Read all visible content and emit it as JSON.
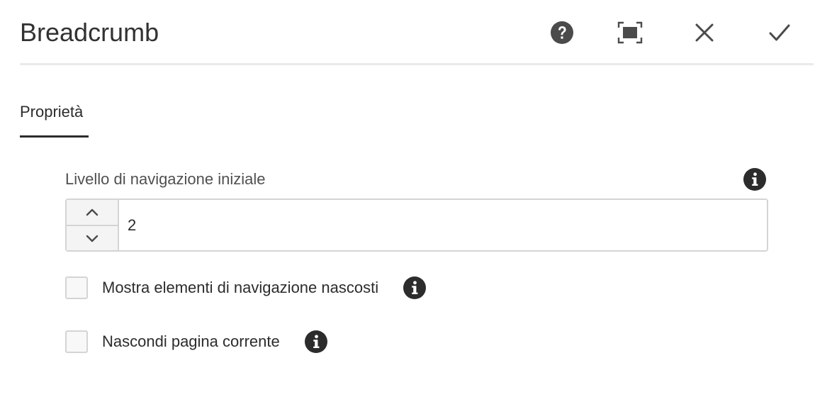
{
  "dialog": {
    "title": "Breadcrumb",
    "actions": [
      {
        "name": "help-button",
        "icon": "help-circle-icon"
      },
      {
        "name": "fullscreen-button",
        "icon": "fullscreen-icon"
      },
      {
        "name": "cancel-button",
        "icon": "close-icon"
      },
      {
        "name": "done-button",
        "icon": "checkmark-icon"
      }
    ]
  },
  "tabs": [
    {
      "label": "Proprietà",
      "active": true
    }
  ],
  "fields": {
    "start_level": {
      "label": "Livello di navigazione iniziale",
      "value": "2"
    },
    "show_hidden": {
      "label": "Mostra elementi di navigazione nascosti",
      "checked": false
    },
    "hide_current": {
      "label": "Nascondi pagina corrente",
      "checked": false
    }
  },
  "colors": {
    "text": "#2c2c2c",
    "icon": "#4b4b4b",
    "border": "#d4d4d4",
    "divider": "#eaeaea"
  }
}
